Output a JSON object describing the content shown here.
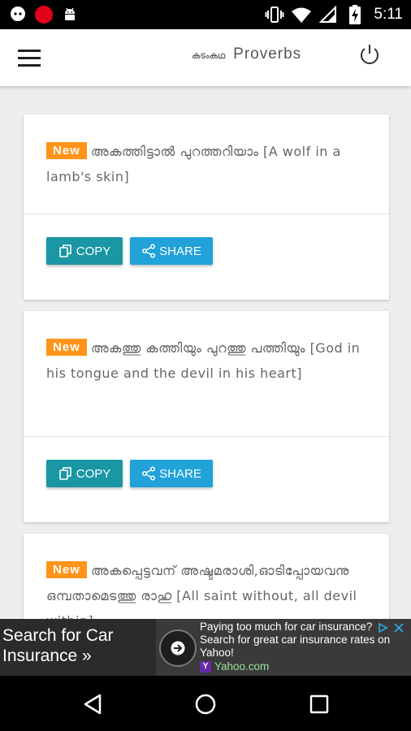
{
  "status_bar": {
    "time": "5:11",
    "left_icons": [
      "messenger-icon",
      "red-dot-icon",
      "android-icon"
    ],
    "right_icons": [
      "vibrate-icon",
      "wifi-icon",
      "signal-icon",
      "battery-charging-icon"
    ]
  },
  "app_bar": {
    "title_malayalam": "കടംകഥ",
    "title": "Proverbs",
    "menu_icon": "hamburger-menu-icon",
    "power_icon": "power-icon"
  },
  "proverbs": [
    {
      "badge": "New",
      "text": "അകത്തിട്ടാൽ പുറത്തറിയാം [A wolf in a lamb's skin]"
    },
    {
      "badge": "New",
      "text": "അകത്തു കത്തിയും പുറത്തു പത്തിയും [God in his tongue and the devil in his heart]"
    },
    {
      "badge": "New",
      "text": "അകപ്പെട്ടവന് അഷ്ടമരാശി,ഓടിപ്പോയവനു ഒമ്പതാമെടത്തു രാഹു [All saint without, all devil within]"
    }
  ],
  "buttons": {
    "copy": "COPY",
    "share": "SHARE"
  },
  "ad": {
    "left_text": "Search for Car Insurance »",
    "headline": "Paying too much for car insurance?",
    "description": "Search for great car insurance rates on Yahoo!",
    "source": "Yahoo.com",
    "accent": "#1a96a4",
    "badge_color": "#ff9418"
  },
  "nav_bar": {
    "icons": [
      "back-icon",
      "home-icon",
      "recents-icon"
    ]
  }
}
